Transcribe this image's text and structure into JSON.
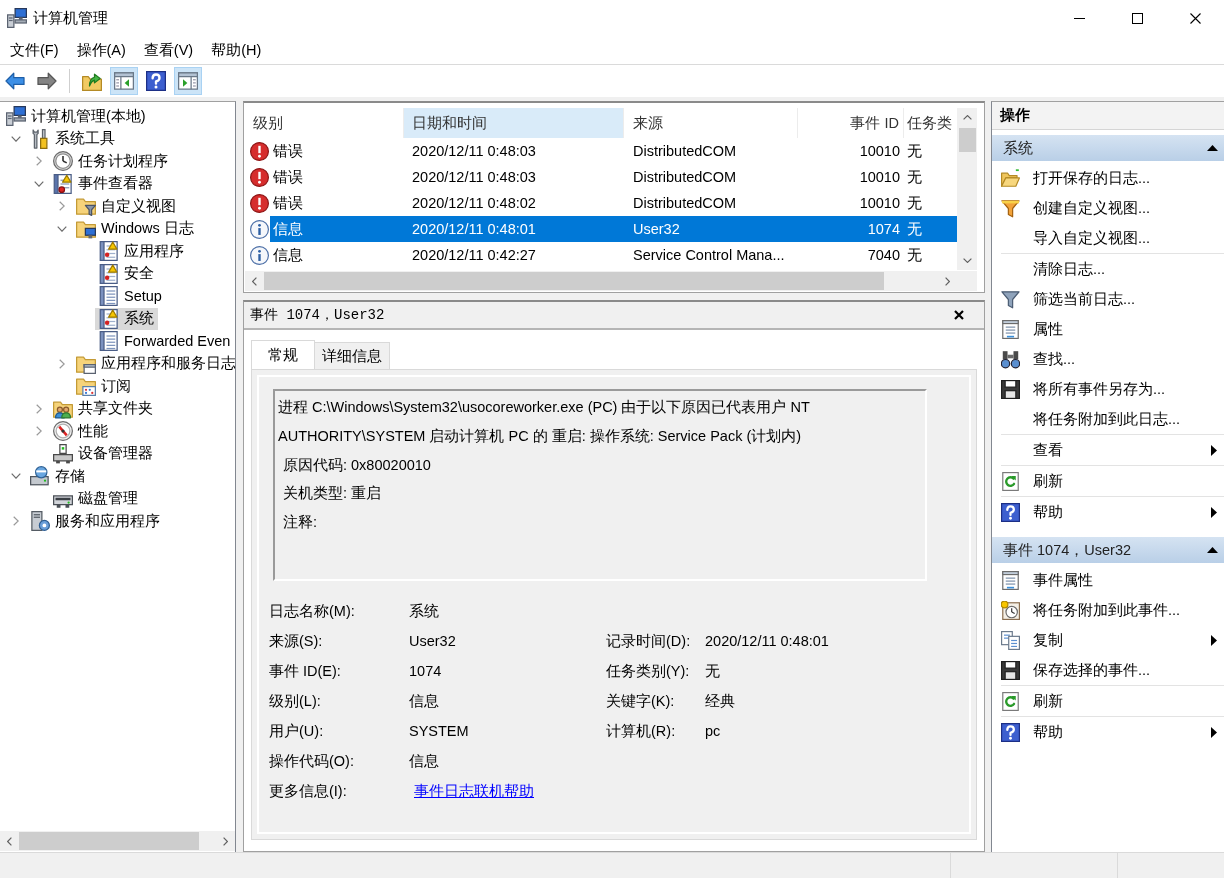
{
  "window": {
    "title": "计算机管理"
  },
  "menu": [
    "文件(F)",
    "操作(A)",
    "查看(V)",
    "帮助(H)"
  ],
  "toolbar": [
    [
      {
        "kind": "back",
        "disabled": false,
        "pressed": false
      },
      {
        "kind": "forward",
        "disabled": true,
        "pressed": false
      }
    ],
    [
      {
        "kind": "up",
        "disabled": false,
        "pressed": false
      },
      {
        "kind": "tree",
        "disabled": false,
        "pressed": true
      },
      {
        "kind": "help",
        "disabled": false,
        "pressed": false
      },
      {
        "kind": "actions",
        "disabled": false,
        "pressed": true
      }
    ]
  ],
  "tree": {
    "label": "计算机管理(本地)",
    "kind": "computer",
    "selected": false,
    "children": [
      {
        "label": "系统工具",
        "kind": "tools",
        "selected": false,
        "expanded": true,
        "children": [
          {
            "label": "任务计划程序",
            "kind": "clock",
            "selected": false,
            "expanded": false
          },
          {
            "label": "事件查看器",
            "kind": "eventlog",
            "selected": false,
            "expanded": true,
            "children": [
              {
                "label": "自定义视图",
                "kind": "filterfolder",
                "selected": false,
                "expanded": false
              },
              {
                "label": "Windows 日志",
                "kind": "logfolder",
                "selected": false,
                "expanded": true,
                "children": [
                  {
                    "label": "应用程序",
                    "kind": "warnlog",
                    "selected": false
                  },
                  {
                    "label": "安全",
                    "kind": "warnlog",
                    "selected": false
                  },
                  {
                    "label": "Setup",
                    "kind": "log",
                    "selected": false
                  },
                  {
                    "label": "系统",
                    "kind": "warnlog",
                    "selected": true
                  },
                  {
                    "label": "Forwarded Even",
                    "kind": "log",
                    "selected": false
                  }
                ]
              },
              {
                "label": "应用程序和服务日志",
                "kind": "appfolder",
                "selected": false,
                "expanded": false
              },
              {
                "label": "订阅",
                "kind": "subfolder",
                "selected": false
              }
            ]
          },
          {
            "label": "共享文件夹",
            "kind": "share",
            "selected": false,
            "expanded": false
          },
          {
            "label": "性能",
            "kind": "perf",
            "selected": false,
            "expanded": false
          },
          {
            "label": "设备管理器",
            "kind": "device",
            "selected": false
          }
        ]
      },
      {
        "label": "存储",
        "kind": "storage",
        "selected": false,
        "expanded": true,
        "children": [
          {
            "label": "磁盘管理",
            "kind": "disk",
            "selected": false
          }
        ]
      },
      {
        "label": "服务和应用程序",
        "kind": "services",
        "selected": false,
        "expanded": false
      }
    ]
  },
  "events": {
    "columns": [
      {
        "label": "级别",
        "sorted": false
      },
      {
        "label": "日期和时间",
        "sorted": true
      },
      {
        "label": "来源",
        "sorted": false
      },
      {
        "label": "事件 ID",
        "sorted": false
      },
      {
        "label": "任务类",
        "sorted": false
      }
    ],
    "rows": [
      {
        "kind": "error",
        "selected": false,
        "cells": [
          "错误",
          "2020/12/11 0:48:03",
          "DistributedCOM",
          "10010",
          "无"
        ]
      },
      {
        "kind": "error",
        "selected": false,
        "cells": [
          "错误",
          "2020/12/11 0:48:03",
          "DistributedCOM",
          "10010",
          "无"
        ]
      },
      {
        "kind": "error",
        "selected": false,
        "cells": [
          "错误",
          "2020/12/11 0:48:02",
          "DistributedCOM",
          "10010",
          "无"
        ]
      },
      {
        "kind": "info",
        "selected": true,
        "cells": [
          "信息",
          "2020/12/11 0:48:01",
          "User32",
          "1074",
          "无"
        ]
      },
      {
        "kind": "info",
        "selected": false,
        "cells": [
          "信息",
          "2020/12/11 0:42:27",
          "Service Control Mana...",
          "7040",
          "无"
        ]
      }
    ]
  },
  "detail": {
    "title": "事件 1074，User32",
    "tabs": [
      {
        "label": "常规",
        "selected": true
      },
      {
        "label": "详细信息",
        "selected": false
      }
    ],
    "description": "进程 C:\\Windows\\System32\\usocoreworker.exe (PC) 由于以下原因已代表用户 NT AUTHORITY\\SYSTEM 启动计算机 PC 的 重启: 操作系统: Service Pack (计划内)",
    "details": [
      "原因代码: 0x80020010",
      "关机类型: 重启",
      "注释:"
    ],
    "fields": [
      [
        {
          "label": "日志名称(M):",
          "value": "系统",
          "kind": "text"
        }
      ],
      [
        {
          "label": "来源(S):",
          "value": "User32",
          "kind": "text"
        },
        {
          "label": "记录时间(D):",
          "value": "2020/12/11 0:48:01",
          "kind": "text"
        }
      ],
      [
        {
          "label": "事件 ID(E):",
          "value": "1074",
          "kind": "text"
        },
        {
          "label": "任务类别(Y):",
          "value": "无",
          "kind": "text"
        }
      ],
      [
        {
          "label": "级别(L):",
          "value": "信息",
          "kind": "text"
        },
        {
          "label": "关键字(K):",
          "value": "经典",
          "kind": "text"
        }
      ],
      [
        {
          "label": "用户(U):",
          "value": "SYSTEM",
          "kind": "text"
        },
        {
          "label": "计算机(R):",
          "value": "pc",
          "kind": "text"
        }
      ],
      [
        {
          "label": "操作代码(O):",
          "value": "信息",
          "kind": "text"
        }
      ],
      [
        {
          "label": "更多信息(I):",
          "value": "事件日志联机帮助",
          "kind": "link"
        }
      ]
    ]
  },
  "actions": {
    "title": "操作",
    "sections": [
      {
        "title": "系统",
        "expanded": true,
        "groups": [
          [
            {
              "label": "打开保存的日志...",
              "kind": "open",
              "submenu": false
            },
            {
              "label": "创建自定义视图...",
              "kind": "newview",
              "submenu": false
            },
            {
              "label": "导入自定义视图...",
              "kind": "none",
              "submenu": false
            }
          ],
          [
            {
              "label": "清除日志...",
              "kind": "none",
              "submenu": false
            },
            {
              "label": "筛选当前日志...",
              "kind": "filter",
              "submenu": false
            },
            {
              "label": "属性",
              "kind": "properties",
              "submenu": false
            },
            {
              "label": "查找...",
              "kind": "find",
              "submenu": false
            },
            {
              "label": "将所有事件另存为...",
              "kind": "save",
              "submenu": false
            },
            {
              "label": "将任务附加到此日志...",
              "kind": "none",
              "submenu": false
            }
          ],
          [
            {
              "label": "查看",
              "kind": "none",
              "submenu": true
            }
          ],
          [
            {
              "label": "刷新",
              "kind": "refresh",
              "submenu": false
            }
          ],
          [
            {
              "label": "帮助",
              "kind": "help",
              "submenu": true
            }
          ]
        ]
      },
      {
        "title": "事件 1074，User32",
        "expanded": true,
        "groups": [
          [
            {
              "label": "事件属性",
              "kind": "properties",
              "submenu": false
            },
            {
              "label": "将任务附加到此事件...",
              "kind": "attach",
              "submenu": false
            },
            {
              "label": "复制",
              "kind": "copy",
              "submenu": true
            },
            {
              "label": "保存选择的事件...",
              "kind": "save",
              "submenu": false
            }
          ],
          [
            {
              "label": "刷新",
              "kind": "refresh",
              "submenu": false
            }
          ],
          [
            {
              "label": "帮助",
              "kind": "help",
              "submenu": true
            }
          ]
        ]
      }
    ]
  }
}
